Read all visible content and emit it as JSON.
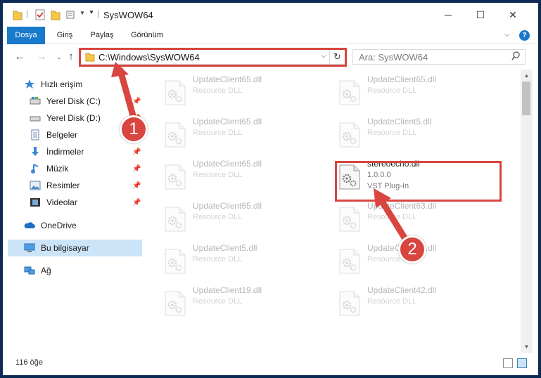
{
  "window": {
    "title": "SysWOW64",
    "controls": {
      "minimize": "─",
      "maximize": "☐",
      "close": "✕"
    }
  },
  "ribbon": {
    "tabs": [
      "Dosya",
      "Giriş",
      "Paylaş",
      "Görünüm"
    ]
  },
  "nav": {
    "address": "C:\\Windows\\SysWOW64",
    "search_placeholder": "Ara: SysWOW64"
  },
  "sidebar": {
    "items": [
      {
        "label": "Hızlı erişim",
        "icon": "star-icon"
      },
      {
        "label": "Yerel Disk (C:)",
        "icon": "drive-icon",
        "pinned": true
      },
      {
        "label": "Yerel Disk (D:)",
        "icon": "drive-icon",
        "pinned": true
      },
      {
        "label": "Belgeler",
        "icon": "documents-icon",
        "pinned": true
      },
      {
        "label": "İndirmeler",
        "icon": "download-icon",
        "pinned": true
      },
      {
        "label": "Müzik",
        "icon": "music-icon",
        "pinned": true
      },
      {
        "label": "Resimler",
        "icon": "pictures-icon",
        "pinned": true
      },
      {
        "label": "Videolar",
        "icon": "videos-icon",
        "pinned": true
      },
      {
        "label": "OneDrive",
        "icon": "cloud-icon"
      },
      {
        "label": "Bu bilgisayar",
        "icon": "computer-icon",
        "selected": true
      },
      {
        "label": "Ağ",
        "icon": "network-icon"
      }
    ]
  },
  "files": [
    {
      "name": "UpdateClient65.dll",
      "desc": "Resource DLL",
      "faded": true
    },
    {
      "name": "UpdateClient65.dll",
      "desc": "Resource DLL",
      "faded": true
    },
    {
      "name": "UpdateClient65.dll",
      "desc": "Resource DLL",
      "faded": true
    },
    {
      "name": "UpdateClient5.dll",
      "desc": "Resource DLL",
      "faded": true
    },
    {
      "name": "UpdateClient65.dll",
      "desc": "Resource DLL",
      "faded": true
    },
    {
      "name": "stereoecho.dll",
      "version": "1.0.0.0",
      "desc": "VST Plug-In",
      "faded": false
    },
    {
      "name": "UpdateClient65.dll",
      "desc": "Resource DLL",
      "faded": true
    },
    {
      "name": "UpdateClient63.dll",
      "desc": "Resource DLL",
      "faded": true
    },
    {
      "name": "UpdateClient5.dll",
      "desc": "Resource DLL",
      "faded": true
    },
    {
      "name": "UpdateClient63.dll",
      "desc": "Resource DLL",
      "faded": true
    },
    {
      "name": "UpdateClient19.dll",
      "desc": "Resource DLL",
      "faded": true
    },
    {
      "name": "UpdateClient42.dll",
      "desc": "Resource DLL",
      "faded": true
    }
  ],
  "status": {
    "count": "116 öğe"
  },
  "annotations": {
    "step1": "1",
    "step2": "2",
    "color": "#d9453f"
  }
}
